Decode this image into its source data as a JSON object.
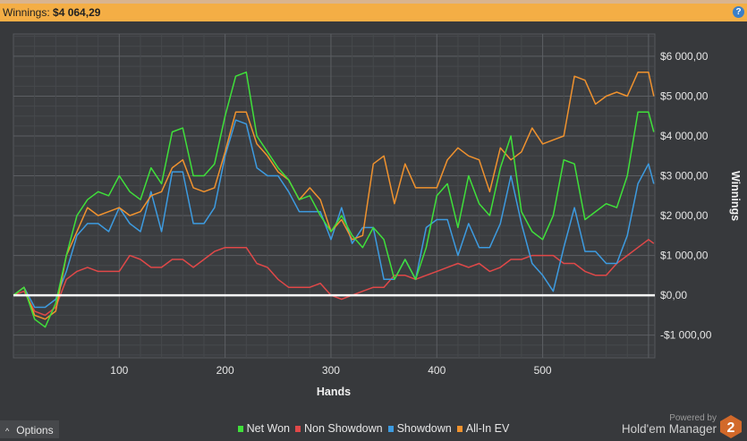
{
  "header": {
    "label": "Winnings:",
    "value": "$4 064,29",
    "help_icon": "question-icon"
  },
  "options_label": "Options",
  "branding": {
    "powered_by": "Powered by",
    "product": "Hold'em Manager",
    "logo_text": "2"
  },
  "chart_data": {
    "type": "line",
    "xlabel": "Hands",
    "ylabel": "Winnings",
    "xlim": [
      0,
      606
    ],
    "ylim": [
      -1570,
      6560
    ],
    "x_ticks": [
      100,
      200,
      300,
      400,
      500
    ],
    "y_ticks": [
      {
        "v": -1000,
        "label": "-$1 000,00"
      },
      {
        "v": 0,
        "label": "$0,00"
      },
      {
        "v": 1000,
        "label": "$1 000,00"
      },
      {
        "v": 2000,
        "label": "$2 000,00"
      },
      {
        "v": 3000,
        "label": "$3 000,00"
      },
      {
        "v": 4000,
        "label": "$4 000,00"
      },
      {
        "v": 5000,
        "label": "$5 000,00"
      },
      {
        "v": 6000,
        "label": "$6 000,00"
      }
    ],
    "grid": true,
    "legend": "bottom-center",
    "x": [
      0,
      10,
      20,
      30,
      40,
      50,
      60,
      70,
      80,
      90,
      100,
      110,
      120,
      130,
      140,
      150,
      160,
      170,
      180,
      190,
      200,
      210,
      220,
      230,
      240,
      250,
      260,
      270,
      280,
      290,
      300,
      310,
      320,
      330,
      340,
      350,
      360,
      370,
      380,
      390,
      400,
      410,
      420,
      430,
      440,
      450,
      460,
      470,
      480,
      490,
      500,
      510,
      520,
      530,
      540,
      550,
      560,
      570,
      580,
      590,
      600,
      605
    ],
    "series": [
      {
        "name": "Net Won",
        "color": "#3fe03a",
        "values": [
          0,
          200,
          -600,
          -800,
          -200,
          1000,
          2000,
          2400,
          2600,
          2500,
          3000,
          2600,
          2400,
          3200,
          2800,
          4100,
          4200,
          3000,
          3000,
          3300,
          4500,
          5500,
          5600,
          4000,
          3600,
          3200,
          2900,
          2400,
          2500,
          2000,
          1600,
          2000,
          1500,
          1200,
          1700,
          1400,
          400,
          900,
          400,
          1200,
          2500,
          2800,
          1700,
          3000,
          2300,
          2000,
          3200,
          4000,
          2100,
          1600,
          1400,
          2000,
          3400,
          3300,
          1900,
          2100,
          2300,
          2200,
          3000,
          4600,
          4600,
          4100
        ]
      },
      {
        "name": "Non Showdown",
        "color": "#e04848",
        "values": [
          0,
          100,
          -400,
          -500,
          -300,
          400,
          600,
          700,
          600,
          600,
          600,
          1000,
          900,
          700,
          700,
          900,
          900,
          700,
          900,
          1100,
          1200,
          1200,
          1200,
          800,
          700,
          400,
          200,
          200,
          200,
          300,
          0,
          -100,
          0,
          100,
          200,
          200,
          500,
          500,
          400,
          500,
          600,
          700,
          800,
          700,
          800,
          600,
          700,
          900,
          900,
          1000,
          1000,
          1000,
          800,
          800,
          600,
          500,
          500,
          800,
          1000,
          1200,
          1400,
          1300
        ]
      },
      {
        "name": "Showdown",
        "color": "#3d9be0",
        "values": [
          0,
          200,
          -300,
          -300,
          -100,
          600,
          1500,
          1800,
          1800,
          1600,
          2200,
          1800,
          1600,
          2600,
          1600,
          3100,
          3100,
          1800,
          1800,
          2200,
          3500,
          4400,
          4300,
          3200,
          3000,
          3000,
          2600,
          2100,
          2100,
          2100,
          1400,
          2200,
          1300,
          1700,
          1700,
          400,
          400,
          900,
          400,
          1700,
          1900,
          1900,
          1000,
          1800,
          1200,
          1200,
          1800,
          3000,
          1800,
          800,
          500,
          100,
          1200,
          2200,
          1100,
          1100,
          800,
          800,
          1500,
          2800,
          3300,
          2800
        ]
      },
      {
        "name": "All-In EV",
        "color": "#f0922e",
        "values": [
          0,
          200,
          -500,
          -600,
          -400,
          1000,
          1600,
          2200,
          2000,
          2100,
          2200,
          2000,
          2100,
          2500,
          2600,
          3200,
          3400,
          2700,
          2600,
          2700,
          3600,
          4600,
          4600,
          3800,
          3500,
          3100,
          2900,
          2400,
          2700,
          2400,
          1600,
          1900,
          1400,
          1500,
          3300,
          3500,
          2300,
          3300,
          2700,
          2700,
          2700,
          3400,
          3700,
          3500,
          3400,
          2600,
          3700,
          3400,
          3600,
          4200,
          3800,
          3900,
          4000,
          5500,
          5400,
          4800,
          5000,
          5100,
          5000,
          5600,
          5600,
          5000
        ]
      }
    ]
  }
}
